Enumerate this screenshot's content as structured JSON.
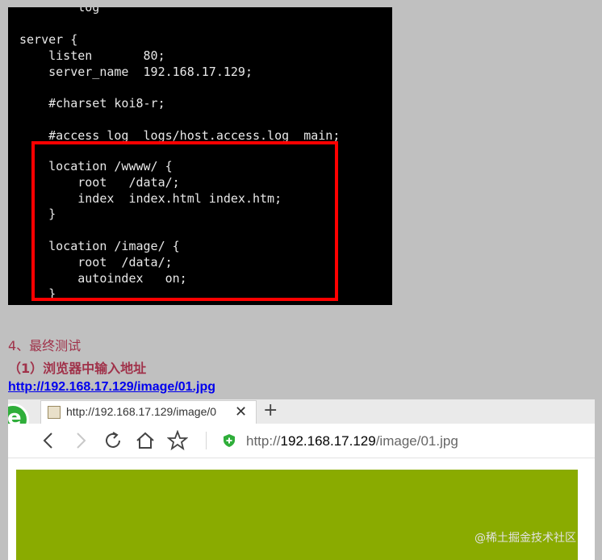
{
  "terminal": {
    "lines": [
      "        log  ",
      "server {",
      "    listen       80;",
      "    server_name  192.168.17.129;",
      "",
      "    #charset koi8-r;",
      "",
      "    #access_log  logs/host.access.log  main;",
      "",
      "    location /wwww/ {",
      "        root   /data/;",
      "        index  index.html index.htm;",
      "    }",
      "",
      "    location /image/ {",
      "        root  /data/;",
      "        autoindex   on;",
      "    }"
    ]
  },
  "doc": {
    "step_heading": "4、最终测试",
    "step_sub": "（1）浏览器中输入地址",
    "link": "http://192.168.17.129/image/01.jpg"
  },
  "browser": {
    "tab_title": "http://192.168.17.129/image/0",
    "tab_close": "✕",
    "new_tab": "+",
    "address_scheme": "http://",
    "address_host": "192.168.17.129",
    "address_path": "/image/01.jpg",
    "image_color": "#8aab00"
  },
  "watermark": "@稀土掘金技术社区"
}
